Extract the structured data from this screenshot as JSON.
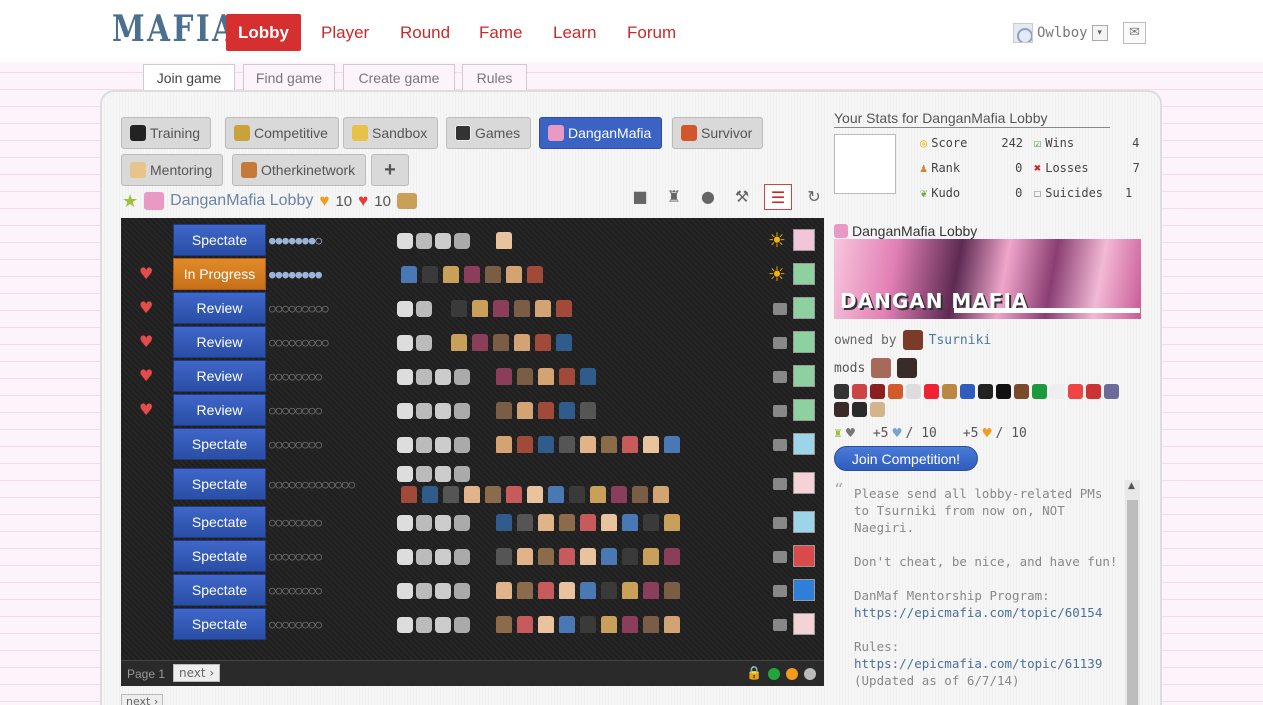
{
  "brand": {
    "logo": "MAFIA"
  },
  "nav": [
    {
      "label": "Lobby",
      "active": true
    },
    {
      "label": "Player"
    },
    {
      "label": "Round"
    },
    {
      "label": "Fame"
    },
    {
      "label": "Learn"
    },
    {
      "label": "Forum"
    }
  ],
  "user": {
    "name": "Owlboy",
    "dropdown_icon": "▾",
    "mail_icon": "✉"
  },
  "subtabs": [
    "Join game",
    "Find game",
    "Create game",
    "Rules"
  ],
  "lobbies": [
    {
      "label": "Training",
      "icon": "graduation-cap-icon"
    },
    {
      "label": "Competitive",
      "icon": "trophy-icon"
    },
    {
      "label": "Sandbox",
      "icon": "sandbox-icon"
    },
    {
      "label": "Games",
      "icon": "dice-icon"
    },
    {
      "label": "DanganMafia",
      "icon": "danganmafia-icon",
      "active": true
    },
    {
      "label": "Survivor",
      "icon": "torch-icon"
    },
    {
      "label": "Mentoring",
      "icon": "bandage-icon"
    },
    {
      "label": "Otherkinetwork",
      "icon": "owl-icon"
    },
    {
      "label": "+",
      "icon": "plus-icon"
    }
  ],
  "lobby_header": {
    "name": "DanganMafia Lobby",
    "orange_count": "10",
    "red_count": "10"
  },
  "games": [
    {
      "action": "Spectate",
      "status": "spectate",
      "dots": "●●●●●●●○",
      "dots_type": "solid",
      "fav": false,
      "sun": true,
      "roles": 4,
      "players": 1
    },
    {
      "action": "In Progress",
      "status": "progress",
      "dots": "●●●●●●●●",
      "dots_type": "solid",
      "fav": true,
      "sun": true,
      "roles": 0,
      "players": 7
    },
    {
      "action": "Review",
      "status": "review",
      "dots": "○○○○○○○○○",
      "dots_type": "hollow",
      "fav": true,
      "sun": false,
      "roles": 2,
      "players": 6
    },
    {
      "action": "Review",
      "status": "review",
      "dots": "○○○○○○○○○",
      "dots_type": "hollow",
      "fav": true,
      "sun": false,
      "roles": 2,
      "players": 6
    },
    {
      "action": "Review",
      "status": "review",
      "dots": "○○○○○○○○",
      "dots_type": "hollow",
      "fav": true,
      "sun": false,
      "roles": 4,
      "players": 5
    },
    {
      "action": "Review",
      "status": "review",
      "dots": "○○○○○○○○",
      "dots_type": "hollow",
      "fav": true,
      "sun": false,
      "roles": 4,
      "players": 5
    },
    {
      "action": "Spectate",
      "status": "spectate",
      "dots": "○○○○○○○○",
      "dots_type": "hollow",
      "fav": false,
      "sun": false,
      "roles": 4,
      "players": 9
    },
    {
      "action": "Spectate",
      "status": "spectate",
      "dots": "○○○○○○○○○○○○○",
      "dots_type": "hollow",
      "fav": false,
      "sun": false,
      "roles": 4,
      "players": 13,
      "tall": true
    },
    {
      "action": "Spectate",
      "status": "spectate",
      "dots": "○○○○○○○○",
      "dots_type": "hollow",
      "fav": false,
      "sun": false,
      "roles": 4,
      "players": 9
    },
    {
      "action": "Spectate",
      "status": "spectate",
      "dots": "○○○○○○○○",
      "dots_type": "hollow",
      "fav": false,
      "sun": false,
      "roles": 4,
      "players": 9
    },
    {
      "action": "Spectate",
      "status": "spectate",
      "dots": "○○○○○○○○",
      "dots_type": "hollow",
      "fav": false,
      "sun": false,
      "roles": 4,
      "players": 9
    },
    {
      "action": "Spectate",
      "status": "spectate",
      "dots": "○○○○○○○○",
      "dots_type": "hollow",
      "fav": false,
      "sun": false,
      "roles": 4,
      "players": 9
    }
  ],
  "pager": {
    "page_label": "Page 1",
    "next_label": "next ›",
    "next2_label": "next ›"
  },
  "stats": {
    "title": "Your Stats for DanganMafia Lobby",
    "score_label": "Score",
    "score": "242",
    "rank_label": "Rank",
    "rank": "0",
    "kudo_label": "Kudo",
    "kudo": "0",
    "wins_label": "Wins",
    "wins": "4",
    "losses_label": "Losses",
    "losses": "7",
    "suicides_label": "Suicides",
    "suicides": "1"
  },
  "lobby_info": {
    "title": "DanganMafia Lobby",
    "banner_text": "DANGAN MAFIA",
    "owned_by_label": "owned by",
    "owner": "Tsurniki",
    "mods_label": "mods",
    "plus_blue": "+5",
    "blue_of": "/ 10",
    "plus_orange": "+5",
    "orange_of": "/ 10",
    "join_label": "Join Competition!"
  },
  "message": {
    "p1": "Please send all lobby-related PMs to Tsurniki from now on, NOT Naegiri.",
    "p2": "Don't cheat, be nice, and have fun!",
    "p3": "DanMaf Mentorship Program:",
    "link1": "https://epicmafia.com/topic/60154",
    "p4": "Rules:",
    "link2": "https://epicmafia.com/topic/61139",
    "p5": "(Updated as of 6/7/14)"
  }
}
